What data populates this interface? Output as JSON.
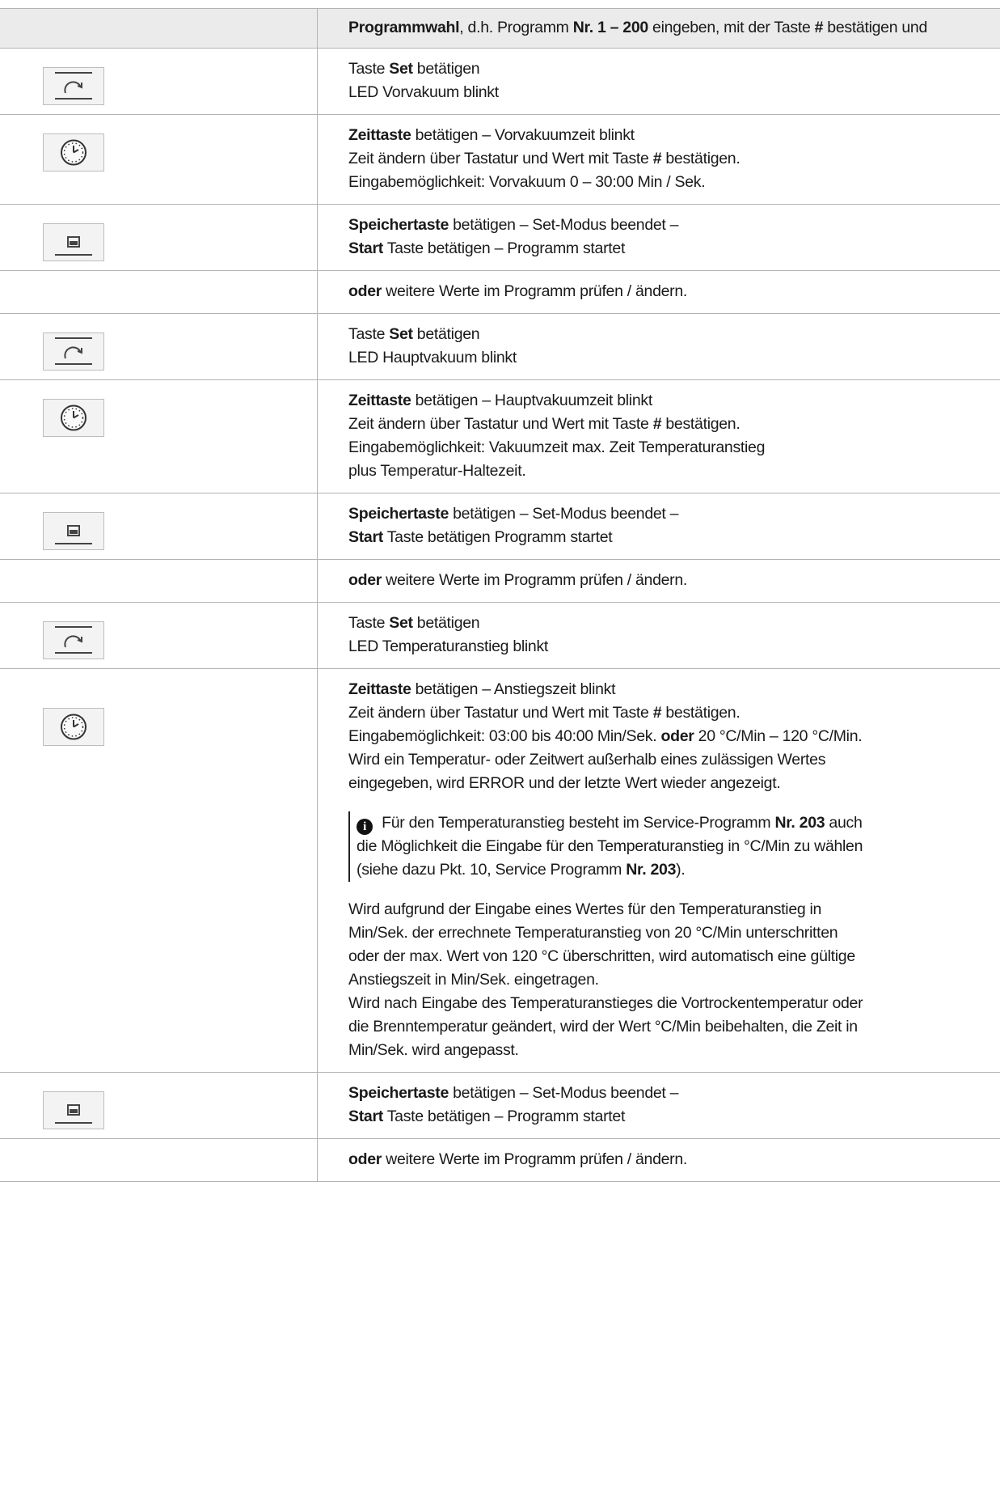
{
  "header": {
    "title": "Programmwahl",
    "title_suffix": ",",
    "line2_a": "d.h. Programm ",
    "line2_b": "Nr. 1 – 200",
    "line2_c": " eingeben, mit der Taste ",
    "line2_d": "#",
    "line2_e": " bestätigen und"
  },
  "rows": [
    {
      "icon": "set-key-icon",
      "lines": [
        {
          "a": "Taste ",
          "b": "Set",
          "c": " betätigen"
        },
        {
          "a": "LED Vorvakuum blinkt"
        }
      ]
    },
    {
      "icon": "clock-key-icon",
      "lines": [
        {
          "b": "Zeittaste",
          "c": " betätigen – Vorvakuumzeit blinkt"
        },
        {
          "a": "Zeit ändern über Tastatur und Wert mit Taste ",
          "b": "#",
          "c": " bestätigen."
        },
        {
          "a": "Eingabemöglichkeit: Vorvakuum  0 – 30:00 Min / Sek."
        }
      ]
    },
    {
      "icon": "save-key-icon",
      "lines": [
        {
          "b": "Speichertaste",
          "c": " betätigen – Set-Modus beendet –"
        },
        {
          "b": "Start",
          "c": " Taste betätigen – Programm startet"
        }
      ]
    },
    {
      "icon": "",
      "lines": [
        {
          "b": "oder",
          "c": " weitere Werte im Programm prüfen / ändern."
        }
      ]
    },
    {
      "icon": "set-key-icon",
      "lines": [
        {
          "a": "Taste ",
          "b": "Set",
          "c": " betätigen"
        },
        {
          "a": "LED Hauptvakuum blinkt"
        }
      ]
    },
    {
      "icon": "clock-key-icon",
      "lines": [
        {
          "b": "Zeittaste",
          "c": " betätigen – Hauptvakuumzeit blinkt"
        },
        {
          "a": "Zeit ändern über Tastatur und Wert mit Taste ",
          "b": "#",
          "c": " bestätigen."
        },
        {
          "a": "Eingabemöglichkeit: Vakuumzeit max. Zeit Temperaturanstieg"
        },
        {
          "a": "plus Temperatur-Haltezeit."
        }
      ]
    },
    {
      "icon": "save-key-icon",
      "lines": [
        {
          "b": "Speichertaste",
          "c": " betätigen – Set-Modus beendet –"
        },
        {
          "b": "Start",
          "c": " Taste betätigen Programm startet"
        }
      ]
    },
    {
      "icon": "",
      "lines": [
        {
          "b": "oder",
          "c": " weitere Werte im Programm prüfen / ändern."
        }
      ]
    },
    {
      "icon": "set-key-icon",
      "lines": [
        {
          "a": "Taste ",
          "b": "Set",
          "c": " betätigen"
        },
        {
          "a": "LED Temperaturanstieg blinkt"
        }
      ]
    },
    {
      "icon": "clock-key-icon",
      "lines": [
        {
          "b": "Zeittaste",
          "c": " betätigen – Anstiegszeit blinkt"
        },
        {
          "a": "Zeit ändern über Tastatur und Wert mit Taste ",
          "b": "#",
          "c": " bestätigen."
        },
        {
          "a": "Eingabemöglichkeit: 03:00 bis 40:00 Min/Sek. ",
          "b": "oder",
          "c": " 20 °C/Min – 120 °C/Min."
        },
        {
          "a": "Wird ein Temperatur- oder Zeitwert außerhalb eines zulässigen Wertes"
        },
        {
          "a": "eingegeben, wird ERROR und der letzte Wert wieder angezeigt."
        }
      ],
      "note": [
        {
          "a": " Für den Temperaturanstieg besteht im Service-Programm ",
          "b": "Nr. 203",
          "c": " auch"
        },
        {
          "a": "die Möglichkeit die Eingabe für den Temperaturanstieg in °C/Min zu wählen"
        },
        {
          "a": "(siehe dazu Pkt. 10, Service Programm ",
          "b": "Nr. 203",
          "c": ")."
        }
      ],
      "para": [
        {
          "a": "Wird aufgrund der Eingabe eines Wertes für den Temperaturanstieg in"
        },
        {
          "a": "Min/Sek. der errechnete Temperaturanstieg von 20 °C/Min unterschritten"
        },
        {
          "a": "oder der max. Wert von 120 °C überschritten, wird automatisch eine gültige"
        },
        {
          "a": "Anstiegszeit in Min/Sek. eingetragen."
        },
        {
          "a": "Wird nach Eingabe des Temperaturanstieges die Vortrockentemperatur oder"
        },
        {
          "a": "die Brenntemperatur geändert, wird der Wert °C/Min beibehalten, die Zeit in"
        },
        {
          "a": "Min/Sek. wird angepasst."
        }
      ]
    },
    {
      "icon": "save-key-icon",
      "lines": [
        {
          "b": "Speichertaste",
          "c": " betätigen – Set-Modus beendet –"
        },
        {
          "b": "Start",
          "c": " Taste betätigen – Programm startet"
        }
      ]
    },
    {
      "icon": "",
      "lines": [
        {
          "b": "oder",
          "c": " weitere Werte im Programm prüfen / ändern."
        }
      ]
    }
  ]
}
